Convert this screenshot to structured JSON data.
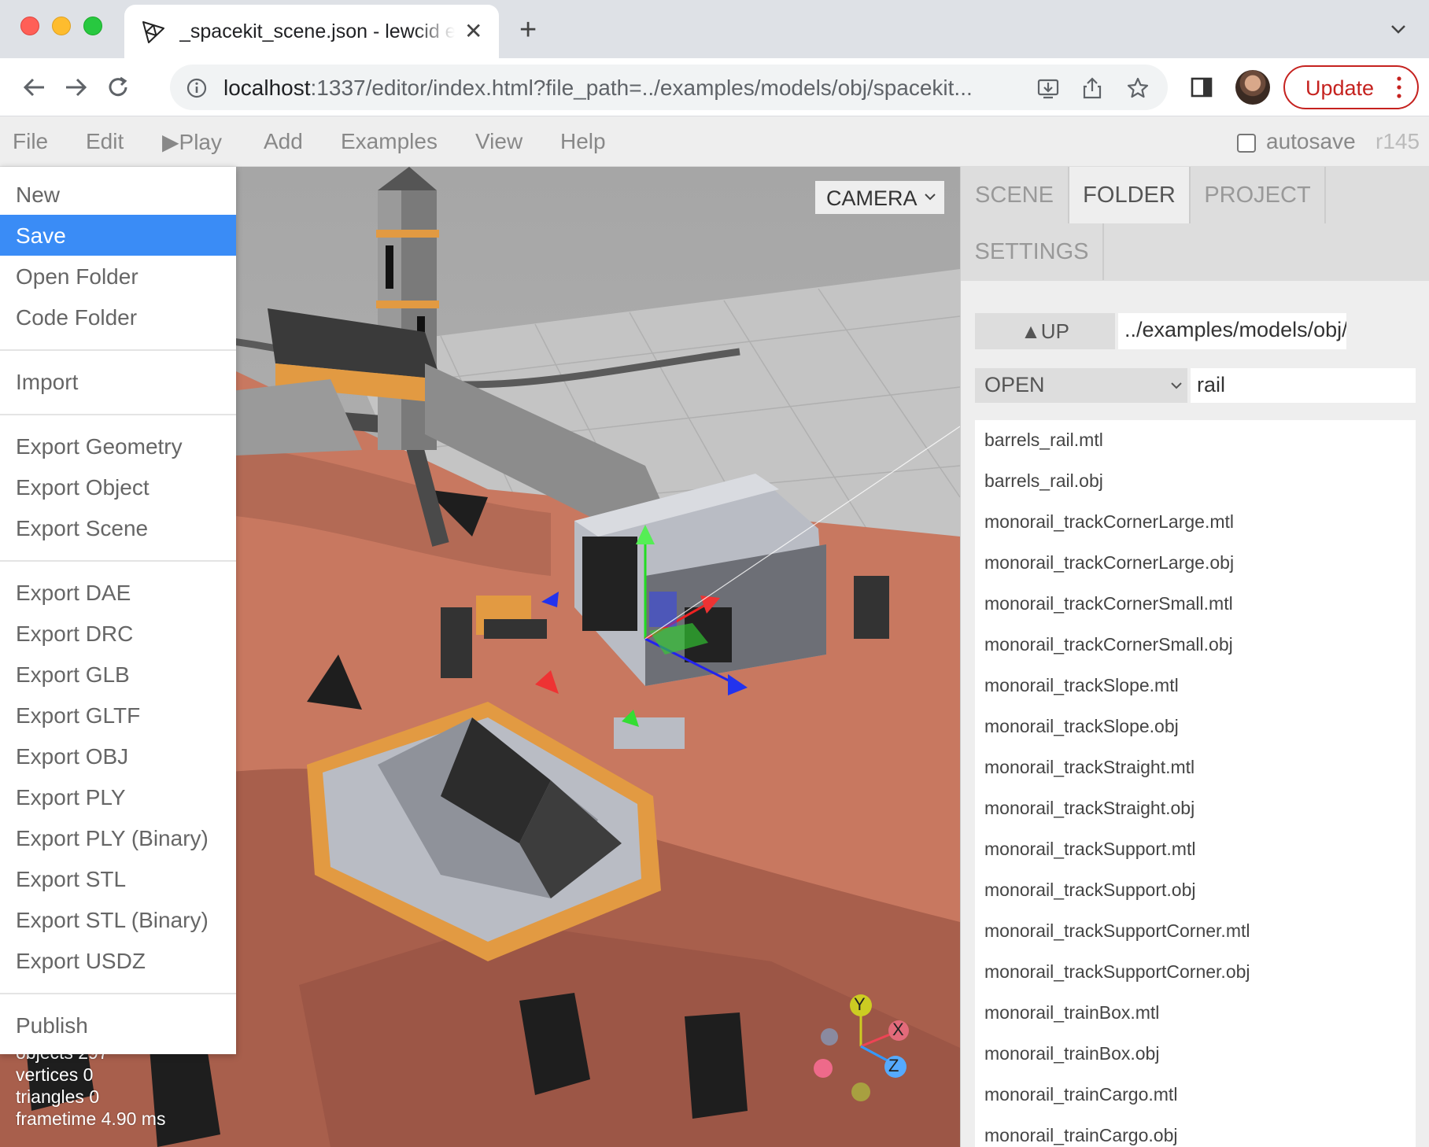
{
  "browser": {
    "tab_title": "_spacekit_scene.json - lewcid editor",
    "url_host": "localhost",
    "url_rest": ":1337/editor/index.html?file_path=../examples/models/obj/spacekit...",
    "update_label": "Update",
    "accent": "#c5221f"
  },
  "menubar": {
    "items": [
      "File",
      "Edit",
      "▶Play",
      "Add",
      "Examples",
      "View",
      "Help"
    ],
    "autosave_label": "autosave",
    "revision": "r145"
  },
  "file_menu": {
    "groups": [
      [
        "New",
        "Save",
        "Open Folder",
        "Code Folder"
      ],
      [
        "Import"
      ],
      [
        "Export Geometry",
        "Export Object",
        "Export Scene"
      ],
      [
        "Export DAE",
        "Export DRC",
        "Export GLB",
        "Export GLTF",
        "Export OBJ",
        "Export PLY",
        "Export PLY (Binary)",
        "Export STL",
        "Export STL (Binary)",
        "Export USDZ"
      ],
      [
        "Publish"
      ]
    ],
    "active_item": "Save",
    "active_color": "#3a8cf6"
  },
  "viewport": {
    "camera_label": "CAMERA",
    "stats": [
      {
        "label": "objects",
        "value": "297"
      },
      {
        "label": "vertices",
        "value": "0"
      },
      {
        "label": "triangles",
        "value": "0"
      },
      {
        "label": "frametime",
        "value": "4.90 ms"
      }
    ],
    "axes": {
      "x": "X",
      "y": "Y",
      "z": "Z"
    },
    "ground_color": "#c87860"
  },
  "sidebar": {
    "tabs": [
      "SCENE",
      "FOLDER",
      "PROJECT",
      "SETTINGS"
    ],
    "selected_tab": "FOLDER",
    "up_label": "▲UP",
    "path_value": "../examples/models/obj/",
    "open_label": "OPEN",
    "filter_value": "rail",
    "files": [
      "barrels_rail.mtl",
      "barrels_rail.obj",
      "monorail_trackCornerLarge.mtl",
      "monorail_trackCornerLarge.obj",
      "monorail_trackCornerSmall.mtl",
      "monorail_trackCornerSmall.obj",
      "monorail_trackSlope.mtl",
      "monorail_trackSlope.obj",
      "monorail_trackStraight.mtl",
      "monorail_trackStraight.obj",
      "monorail_trackSupport.mtl",
      "monorail_trackSupport.obj",
      "monorail_trackSupportCorner.mtl",
      "monorail_trackSupportCorner.obj",
      "monorail_trainBox.mtl",
      "monorail_trainBox.obj",
      "monorail_trainCargo.mtl",
      "monorail_trainCargo.obj"
    ]
  }
}
